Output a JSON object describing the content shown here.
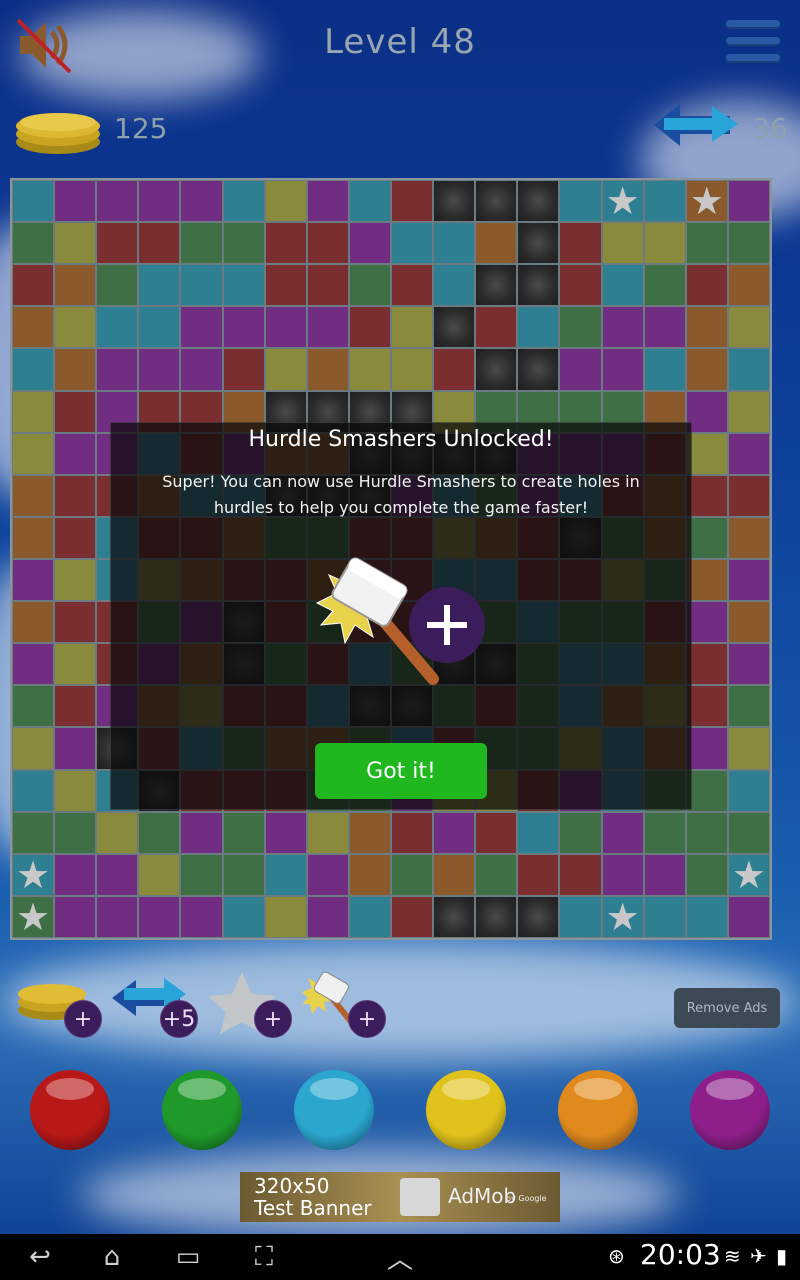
{
  "header": {
    "title": "Level 48",
    "coins": "125",
    "swaps": "36"
  },
  "board": {
    "rows": [
      "bppppbypbrkkkbsb",
      "gyrrggrrpbbokryyg",
      "rogbbbrrgrbkkrbg",
      "oybbpppprykrbgpp",
      "bopppryoyyrkkppbo",
      "yrprrokkkkyggggop",
      "yppbrpookkkkpppr",
      "orrobbkkkpbgpbr",
      "orbrroggrryorkgog",
      "pybyorrorrbbrrygo",
      "orrgpkrgrrbgbggrp",
      "pyrpokgrbgkkgbbor",
      "grpoyrrbkkgrgboyr",
      "ypkrbgoogbrggybop",
      "bybkrrrggpyyrpbgg",
      "ggygpgpyorprbgpg",
      "sppyggbpogogrrppg"
    ]
  },
  "dialog": {
    "title": "Hurdle Smashers Unlocked!",
    "text": "Super! You can now use Hurdle Smashers to create holes in hurdles to help you complete the game faster!",
    "button": "Got it!"
  },
  "powerups": [
    {
      "icon": "coins-icon",
      "badge": "+"
    },
    {
      "icon": "swap-icon",
      "badge": "+5"
    },
    {
      "icon": "star-icon",
      "badge": "+"
    },
    {
      "icon": "hammer-icon",
      "badge": "+"
    }
  ],
  "remove_ads": "Remove Ads",
  "balls": [
    {
      "name": "red",
      "color": "#b81818"
    },
    {
      "name": "green",
      "color": "#1f9a2a"
    },
    {
      "name": "blue",
      "color": "#2aa6cf"
    },
    {
      "name": "yellow",
      "color": "#e0c21c"
    },
    {
      "name": "orange",
      "color": "#e08a1e"
    },
    {
      "name": "purple",
      "color": "#8e1f8a"
    }
  ],
  "ad": {
    "size": "320x50",
    "label": "Test Banner",
    "brand": "AdMob",
    "by": "by Google"
  },
  "status": {
    "time": "20:03"
  }
}
